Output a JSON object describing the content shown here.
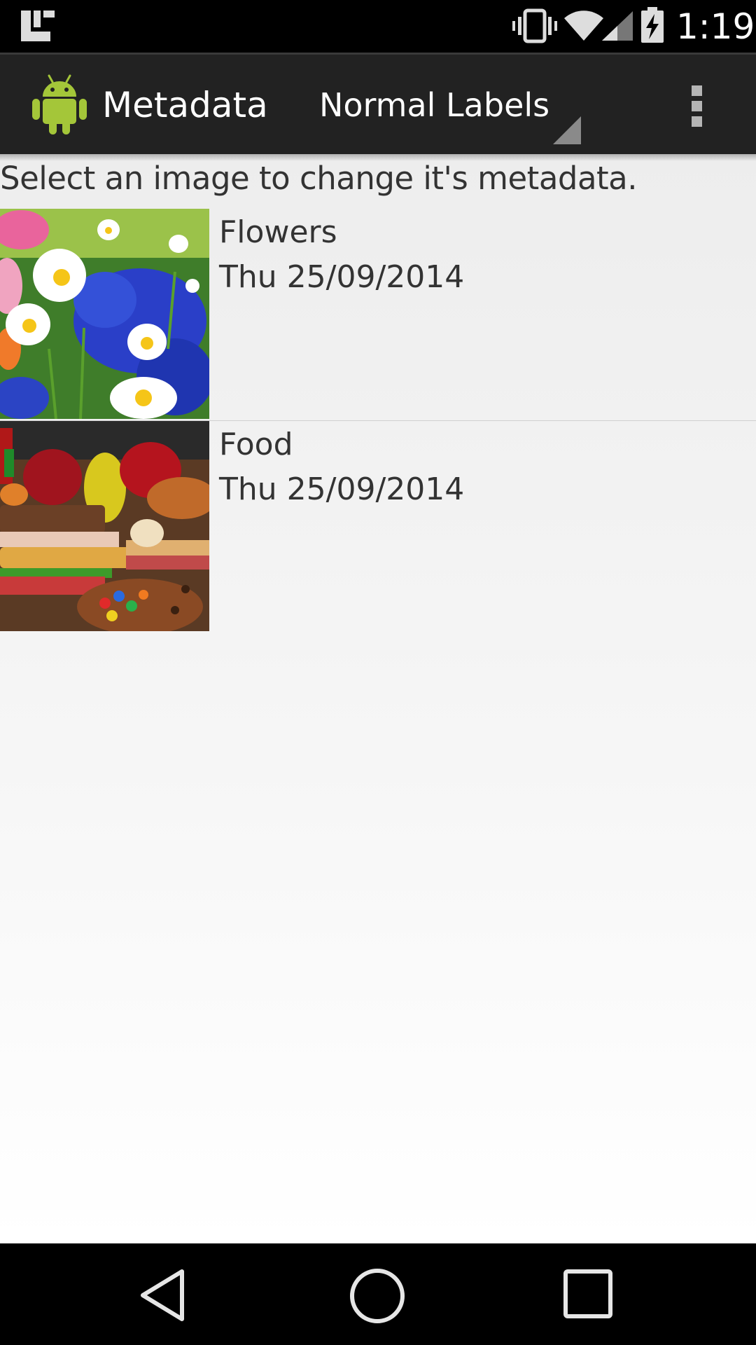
{
  "status_bar": {
    "time": "1:19",
    "icons": [
      "notification-icon",
      "vibrate-icon",
      "wifi-icon",
      "signal-icon",
      "battery-charging-icon"
    ]
  },
  "action_bar": {
    "app_icon": "android-icon",
    "title": "Metadata",
    "spinner_selected": "Normal Labels",
    "overflow_icon": "more-vert-icon"
  },
  "content": {
    "instructions": "Select an image to change it's metadata.",
    "items": [
      {
        "title": "Flowers",
        "date": "Thu 25/09/2014",
        "thumbnail": "flowers-photo"
      },
      {
        "title": "Food",
        "date": "Thu 25/09/2014",
        "thumbnail": "food-photo"
      }
    ]
  },
  "nav_bar": {
    "buttons": [
      "back-icon",
      "home-icon",
      "recents-icon"
    ]
  },
  "colors": {
    "action_bar_bg": "#222222",
    "status_bar_bg": "#000000",
    "text_primary": "#333333",
    "android_green": "#a4c639"
  }
}
